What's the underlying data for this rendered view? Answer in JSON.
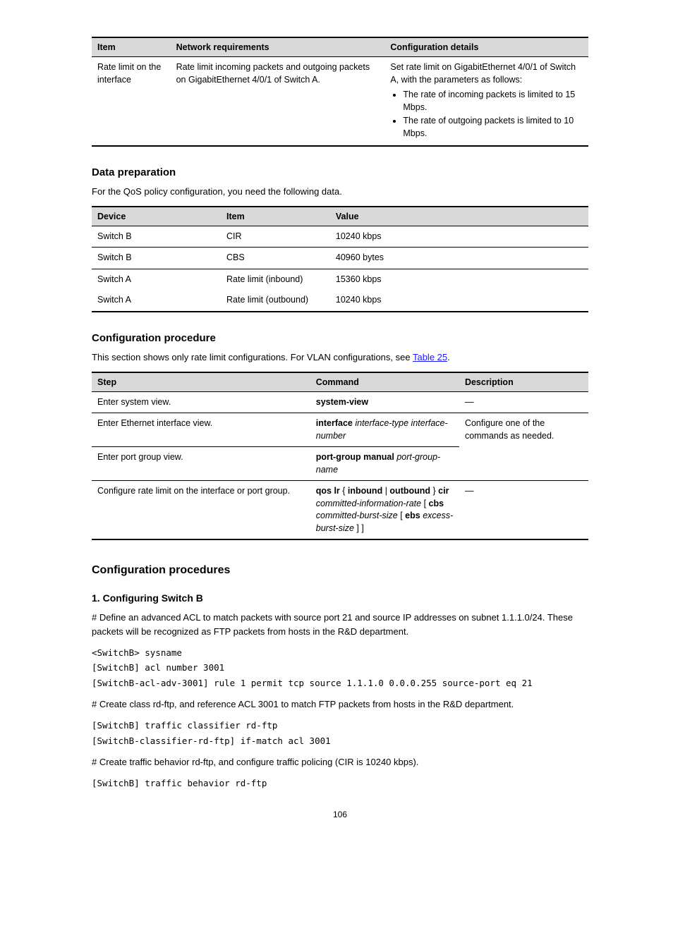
{
  "table1": {
    "headers": [
      "Item",
      "Network requirements",
      "Configuration details"
    ],
    "row": {
      "item": "Rate limit on the interface",
      "req": "Rate limit incoming packets and outgoing packets on GigabitEthernet 4/0/1 of Switch A.",
      "detail_intro": "Set rate limit on GigabitEthernet 4/0/1 of Switch A, with the parameters as follows:",
      "bullets": [
        "The rate of incoming packets is limited to 15 Mbps.",
        "The rate of outgoing packets is limited to 10 Mbps."
      ]
    }
  },
  "section2": {
    "title": "Data preparation",
    "intro": "For the QoS policy configuration, you need the following data.",
    "headers": [
      "Device",
      "Item",
      "Value"
    ],
    "rows": [
      {
        "device": "Switch B",
        "item": "CIR",
        "value": "10240 kbps"
      },
      {
        "device": "Switch B",
        "item": "CBS",
        "value": "40960 bytes"
      },
      {
        "device": "Switch A",
        "item": "Rate limit (inbound)",
        "value": "15360 kbps"
      },
      {
        "device": "Switch A",
        "item": "Rate limit (outbound)",
        "value": "10240 kbps"
      }
    ]
  },
  "section3": {
    "title": "Configuration procedure",
    "caption_prefix": "This section shows only rate limit configurations. For VLAN configurations, see ",
    "caption_link": "Table 25",
    "caption_suffix": ".",
    "headers": [
      "Step",
      "Command",
      "Description"
    ],
    "rows": [
      {
        "step": "Enter system view.",
        "cmd": "system-view",
        "desc": "—",
        "merge_desc": false
      },
      {
        "step": "Enter Ethernet interface view.",
        "cmd": "interface interface-type interface-number",
        "desc": "Configure one of the commands as needed.",
        "merge_desc": "start"
      },
      {
        "step": "Enter port group view.",
        "cmd": "port-group manual port-group-name",
        "desc": "",
        "merge_desc": "cont"
      },
      {
        "step": "Configure rate limit on the interface or port group.",
        "cmd": "qos lr { inbound | outbound } cir committed-information-rate [ cbs committed-burst-size [ ebs excess-burst-size ] ]",
        "desc": "—",
        "merge_desc": false
      }
    ]
  },
  "section4": {
    "title": "Configuration procedures",
    "step1": {
      "title": "Configuring Switch B",
      "num": "1.",
      "para1": "# Define an advanced ACL to match packets with source port 21 and source IP addresses on subnet 1.1.1.0/24. These packets will be recognized as FTP packets from hosts in the R&D department.",
      "code1": [
        "<SwitchB> sysname",
        "[SwitchB] acl number 3001",
        "[SwitchB-acl-adv-3001] rule 1 permit tcp source 1.1.1.0 0.0.0.255 source-port eq 21"
      ],
      "para2": "# Create class rd-ftp, and reference ACL 3001 to match FTP packets from hosts in the R&D department.",
      "code2": [
        "[SwitchB] traffic classifier rd-ftp",
        "[SwitchB-classifier-rd-ftp] if-match acl 3001"
      ],
      "para3": "# Create traffic behavior rd-ftp, and configure traffic policing (CIR is 10240 kbps).",
      "code3": [
        "[SwitchB] traffic behavior rd-ftp"
      ]
    }
  },
  "page_number": "106"
}
